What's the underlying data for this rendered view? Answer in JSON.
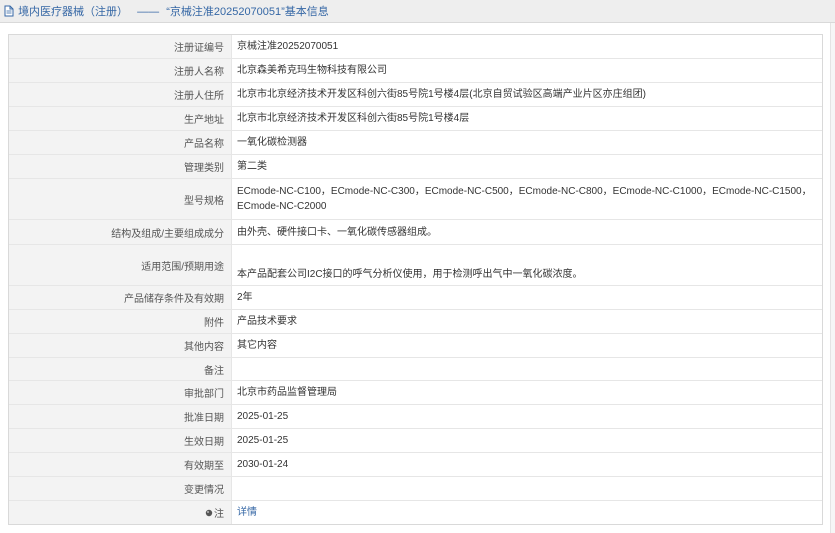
{
  "breadcrumb": {
    "section": "境内医疗器械（注册）",
    "separator": "——",
    "current": "“京械注准20252070051”基本信息"
  },
  "fields": [
    {
      "label": "注册证编号",
      "value": "京械注准20252070051"
    },
    {
      "label": "注册人名称",
      "value": "北京森美希克玛生物科技有限公司"
    },
    {
      "label": "注册人住所",
      "value": "北京市北京经济技术开发区科创六街85号院1号楼4层(北京自贸试验区高端产业片区亦庄组团)"
    },
    {
      "label": "生产地址",
      "value": "北京市北京经济技术开发区科创六街85号院1号楼4层"
    },
    {
      "label": "产品名称",
      "value": "一氧化碳检测器"
    },
    {
      "label": "管理类别",
      "value": "第二类"
    },
    {
      "label": "型号规格",
      "value": "ECmode-NC-C100，ECmode-NC-C300，ECmode-NC-C500，ECmode-NC-C800，ECmode-NC-C1000，ECmode-NC-C1500，ECmode-NC-C2000"
    },
    {
      "label": "结构及组成/主要组成成分",
      "value": "由外壳、硬件接口卡、一氧化碳传感器组成。"
    },
    {
      "label": "适用范围/预期用途",
      "value": "本产品配套公司I2C接口的呼气分析仪使用，用于检测呼出气中一氧化碳浓度。"
    },
    {
      "label": "产品储存条件及有效期",
      "value": "2年"
    },
    {
      "label": "附件",
      "value": "产品技术要求"
    },
    {
      "label": "其他内容",
      "value": "其它内容"
    },
    {
      "label": "备注",
      "value": ""
    },
    {
      "label": "审批部门",
      "value": "北京市药品监督管理局"
    },
    {
      "label": "批准日期",
      "value": "2025-01-25"
    },
    {
      "label": "生效日期",
      "value": "2025-01-25"
    },
    {
      "label": "有效期至",
      "value": "2030-01-24"
    },
    {
      "label": "变更情况",
      "value": ""
    },
    {
      "label": "注",
      "value": "详情",
      "icon": "note-icon"
    }
  ],
  "colors": {
    "link": "#3567a5",
    "label_background": "#f3f3f3",
    "border": "#e6e6e6",
    "topbar_background": "#eeeeee"
  }
}
